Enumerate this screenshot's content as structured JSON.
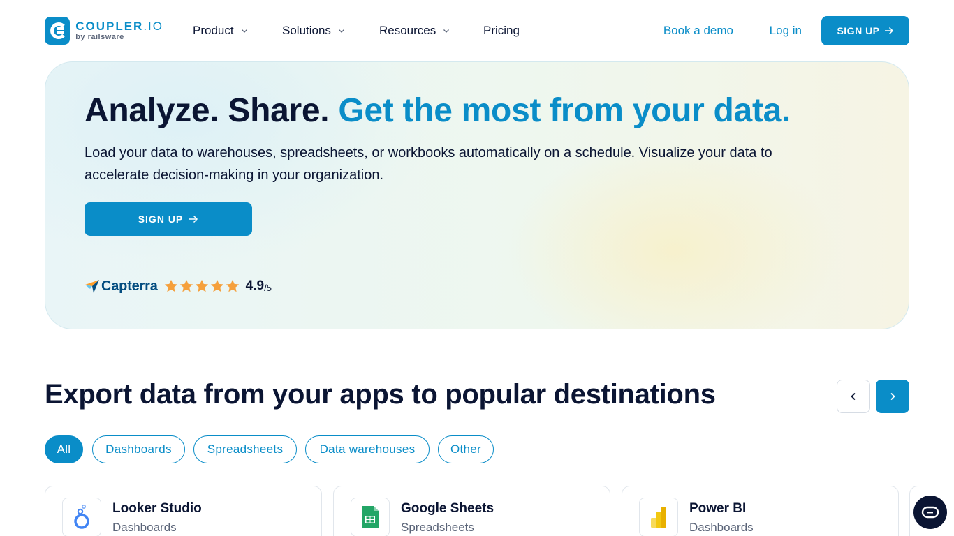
{
  "brand": {
    "name": "COUPLER",
    "name_suffix": ".IO",
    "byline": "by railsware",
    "accent": "#0a8dc8",
    "dark": "#0b1533"
  },
  "nav": {
    "menu": [
      {
        "label": "Product",
        "dropdown": true
      },
      {
        "label": "Solutions",
        "dropdown": true
      },
      {
        "label": "Resources",
        "dropdown": true
      },
      {
        "label": "Pricing",
        "dropdown": false
      }
    ],
    "book_demo": "Book a demo",
    "login": "Log in",
    "signup": "SIGN UP"
  },
  "hero": {
    "title_part1": "Analyze. Share.",
    "title_part2": "Get the most from your data.",
    "description": "Load your data to warehouses, spreadsheets, or workbooks automatically on a schedule. Visualize your data to accelerate decision-making in your organization.",
    "cta": "SIGN UP",
    "rating": {
      "source": "Capterra",
      "stars": 5,
      "value": "4.9",
      "max": "/5",
      "star_color": "#f5a03c"
    }
  },
  "section": {
    "title": "Export data from your apps to popular destinations",
    "filters": [
      {
        "label": "All",
        "active": true
      },
      {
        "label": "Dashboards",
        "active": false
      },
      {
        "label": "Spreadsheets",
        "active": false
      },
      {
        "label": "Data warehouses",
        "active": false
      },
      {
        "label": "Other",
        "active": false
      }
    ],
    "cards": [
      {
        "name": "Looker Studio",
        "category": "Dashboards",
        "icon": "looker-studio-icon"
      },
      {
        "name": "Google Sheets",
        "category": "Spreadsheets",
        "icon": "google-sheets-icon"
      },
      {
        "name": "Power BI",
        "category": "Dashboards",
        "icon": "power-bi-icon"
      }
    ]
  }
}
